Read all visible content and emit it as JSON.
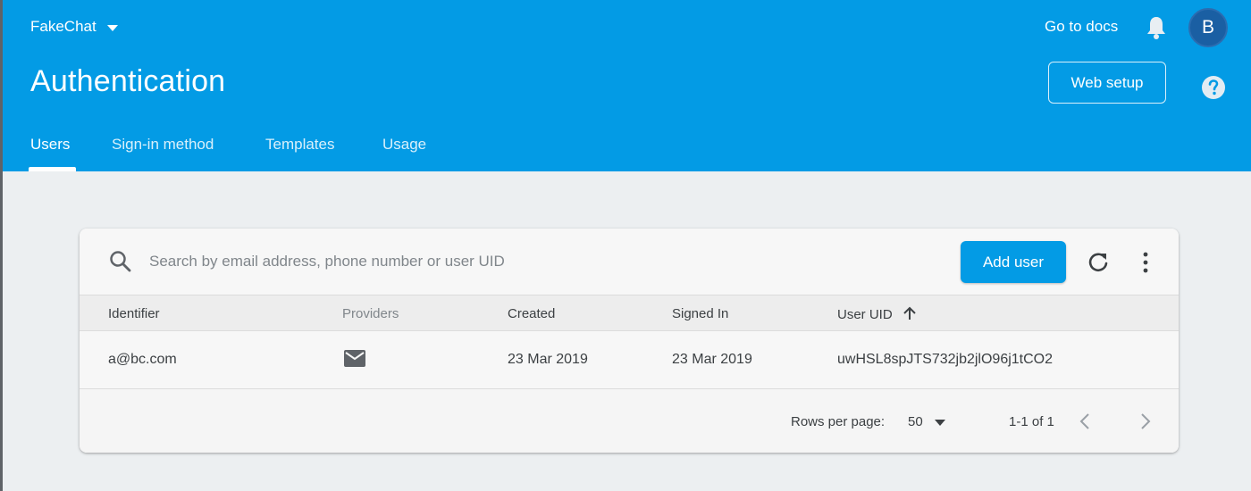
{
  "header": {
    "project_name": "FakeChat",
    "docs_link": "Go to docs",
    "avatar_initial": "B",
    "page_title": "Authentication",
    "web_setup_label": "Web setup"
  },
  "tabs": [
    {
      "label": "Users",
      "active": true
    },
    {
      "label": "Sign-in method",
      "active": false
    },
    {
      "label": "Templates",
      "active": false
    },
    {
      "label": "Usage",
      "active": false
    }
  ],
  "toolbar": {
    "search_placeholder": "Search by email address, phone number or user UID",
    "add_user_label": "Add user"
  },
  "table": {
    "columns": [
      "Identifier",
      "Providers",
      "Created",
      "Signed In",
      "User UID"
    ],
    "sort_column": "User UID",
    "rows": [
      {
        "identifier": "a@bc.com",
        "provider_icon": "mail-icon",
        "created": "23 Mar 2019",
        "signed_in": "23 Mar 2019",
        "uid": "uwHSL8spJTS732jb2jlO96j1tCO2"
      }
    ]
  },
  "pagination": {
    "rows_per_page_label": "Rows per page:",
    "rows_per_page_value": "50",
    "range_text": "1-1 of 1"
  },
  "colors": {
    "brand_blue": "#039be5",
    "page_background": "#eceff1"
  }
}
